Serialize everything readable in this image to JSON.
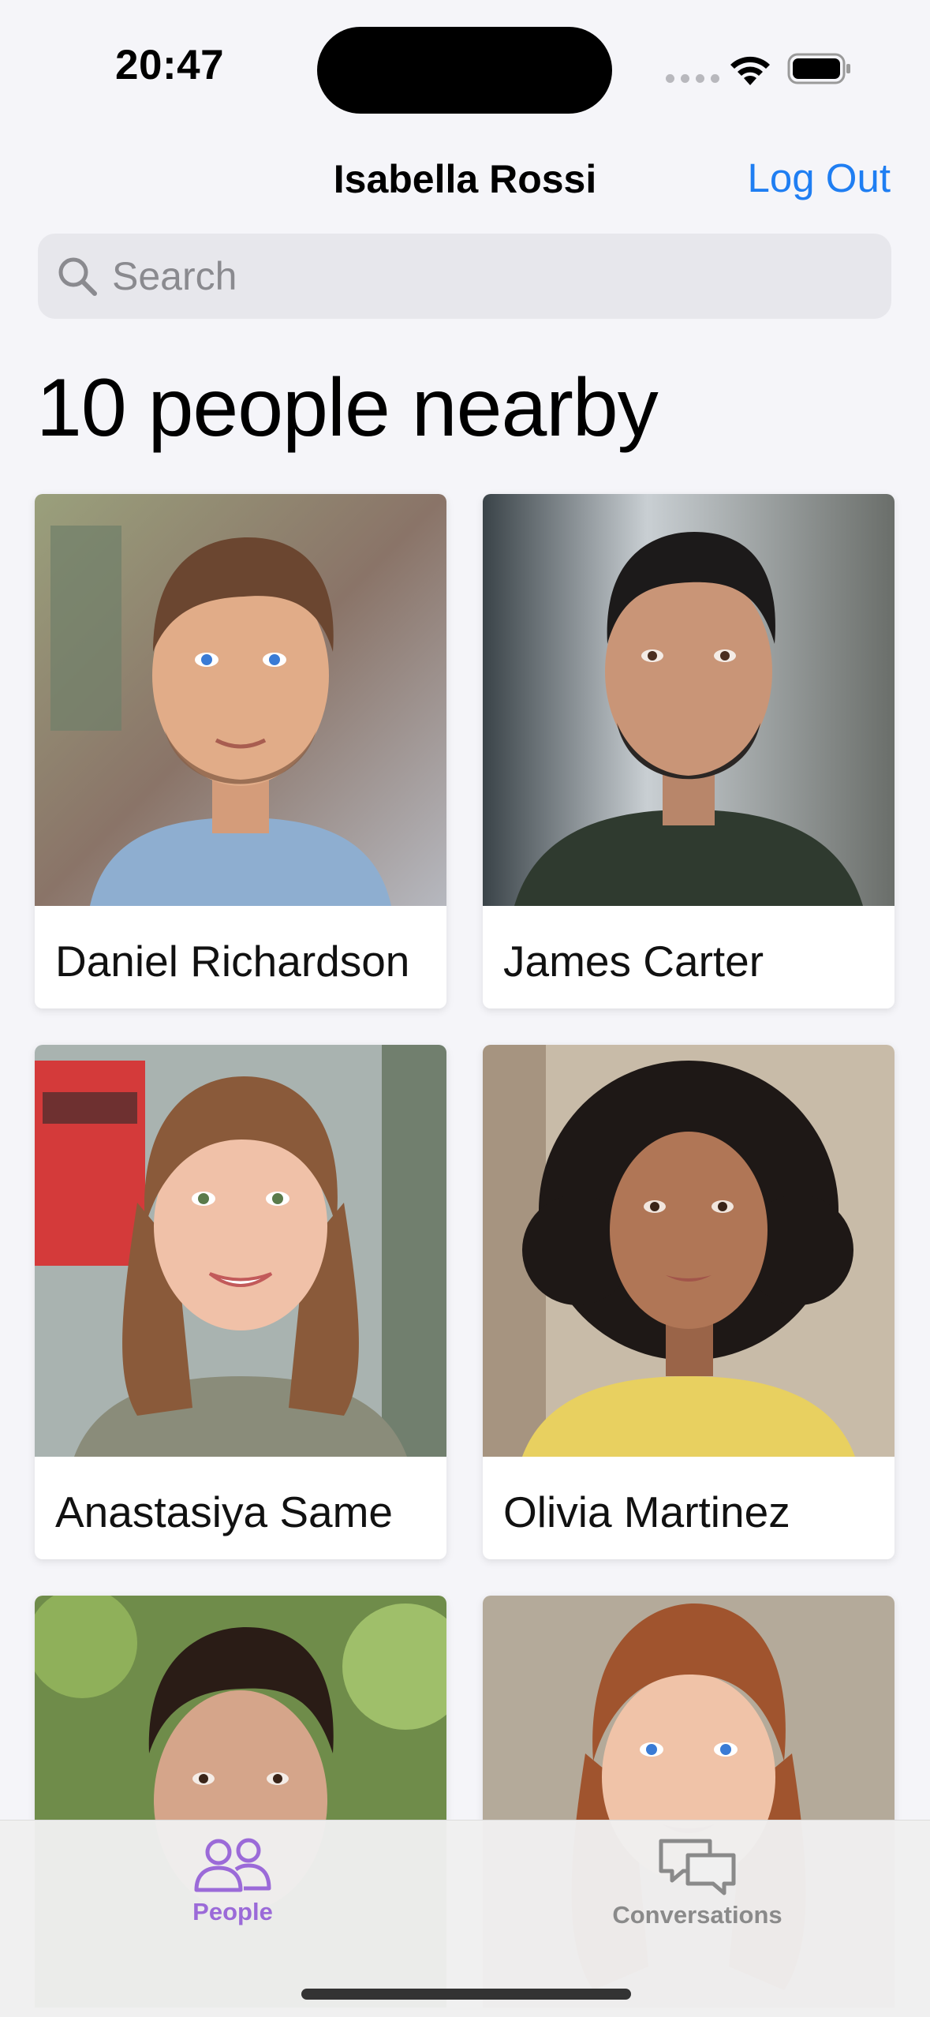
{
  "status_bar": {
    "time": "20:47"
  },
  "nav": {
    "title": "Isabella Rossi",
    "logout_label": "Log Out"
  },
  "search": {
    "placeholder": "Search",
    "value": ""
  },
  "heading": "10 people nearby",
  "people": [
    {
      "name": "Daniel Richardson"
    },
    {
      "name": "James Carter"
    },
    {
      "name": "Anastasiya Same"
    },
    {
      "name": "Olivia Martinez"
    },
    {
      "name": ""
    },
    {
      "name": ""
    }
  ],
  "tabs": [
    {
      "label": "People",
      "active": true,
      "icon": "people-icon"
    },
    {
      "label": "Conversations",
      "active": false,
      "icon": "chat-bubbles-icon"
    }
  ],
  "colors": {
    "accent": "#1f7ef2",
    "tab_active": "#9b6ad8",
    "tab_inactive": "#8a8a8a"
  }
}
